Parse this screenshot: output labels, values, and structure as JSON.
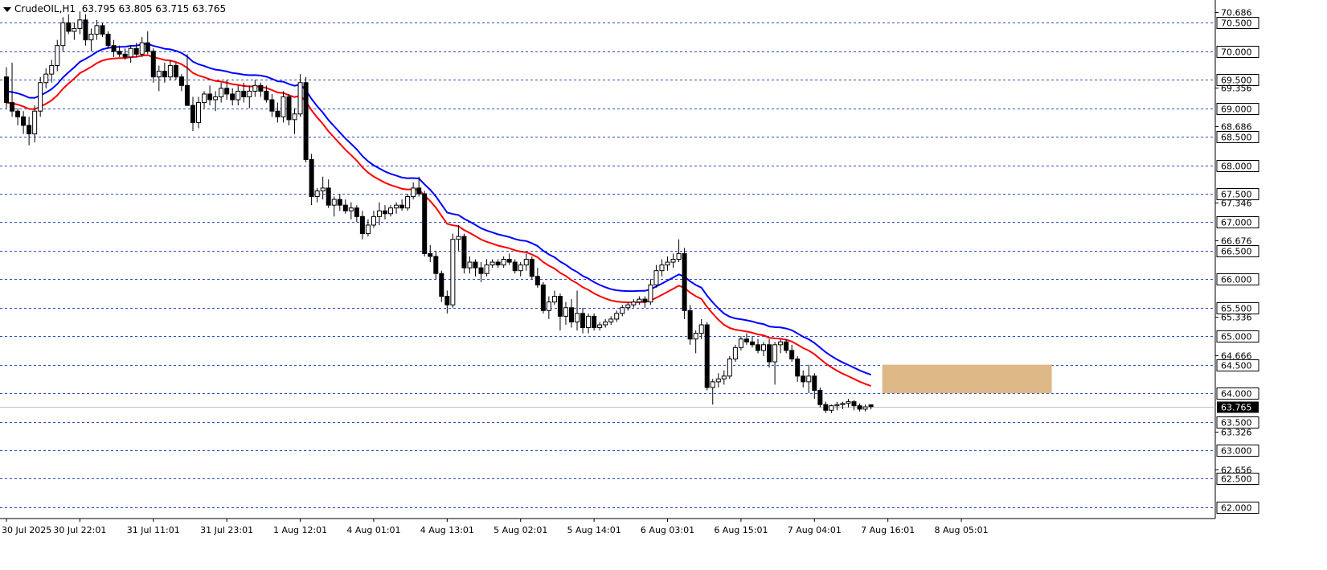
{
  "header": {
    "symbol": "CrudeOIL,H1",
    "ohlc": "63.795 63.805 63.715 63.765"
  },
  "colors": {
    "grid": "#2b4fbf",
    "ma_fast": "#0000ff",
    "ma_slow": "#ff0000",
    "zone": "#deb887",
    "current_label_bg": "#000000",
    "current_label_text": "#ffffff"
  },
  "chart_data": {
    "type": "line",
    "title": "CrudeOIL,H1",
    "ylim": [
      61.8,
      70.9
    ],
    "grid": true,
    "y_levels": [
      70.5,
      70.0,
      69.5,
      69.0,
      68.5,
      68.0,
      67.5,
      67.0,
      66.5,
      66.0,
      65.5,
      65.0,
      64.5,
      64.0,
      63.5,
      63.0,
      62.5,
      62.0
    ],
    "y_level_labels": [
      "70.500",
      "70.000",
      "69.500",
      "69.000",
      "68.500",
      "68.000",
      "67.500",
      "67.000",
      "66.500",
      "66.000",
      "65.500",
      "65.000",
      "64.500",
      "64.000",
      "63.500",
      "63.000",
      "62.500",
      "62.000"
    ],
    "y_tick_values": [
      70.686,
      69.356,
      68.686,
      67.346,
      66.676,
      65.336,
      64.666,
      63.326,
      62.656
    ],
    "y_tick_labels": [
      "70.686",
      "69.356",
      "68.686",
      "67.346",
      "66.676",
      "65.336",
      "64.666",
      "63.326",
      "62.656"
    ],
    "x_labels": [
      "30 Jul 2025",
      "30 Jul 22:01",
      "31 Jul 11:01",
      "31 Jul 23:01",
      "1 Aug 12:01",
      "4 Aug 01:01",
      "4 Aug 13:01",
      "5 Aug 02:01",
      "5 Aug 14:01",
      "6 Aug 03:01",
      "6 Aug 15:01",
      "7 Aug 04:01",
      "7 Aug 16:01",
      "8 Aug 05:01"
    ],
    "x_label_bar_index": [
      0,
      13,
      26,
      39,
      52,
      65,
      78,
      91,
      104,
      117,
      130,
      143,
      156,
      169
    ],
    "current_price": 63.765,
    "current_price_label": "63.765",
    "zone": {
      "x_start_bar": 155,
      "x_end_bar": 185,
      "y_low": 64.0,
      "y_high": 64.5
    },
    "candles": [
      [
        69.55,
        69.72,
        69.0,
        69.1
      ],
      [
        69.1,
        69.8,
        68.85,
        68.95
      ],
      [
        68.95,
        69.0,
        68.7,
        68.85
      ],
      [
        68.85,
        68.95,
        68.55,
        68.7
      ],
      [
        68.7,
        68.85,
        68.35,
        68.55
      ],
      [
        68.55,
        69.05,
        68.4,
        68.95
      ],
      [
        68.95,
        69.55,
        68.85,
        69.45
      ],
      [
        69.45,
        69.7,
        69.35,
        69.6
      ],
      [
        69.6,
        69.85,
        69.45,
        69.75
      ],
      [
        69.75,
        70.2,
        69.65,
        70.1
      ],
      [
        70.1,
        70.6,
        70.0,
        70.5
      ],
      [
        70.5,
        70.65,
        70.3,
        70.35
      ],
      [
        70.35,
        70.5,
        70.2,
        70.4
      ],
      [
        70.4,
        70.7,
        70.3,
        70.55
      ],
      [
        70.55,
        70.65,
        70.1,
        70.2
      ],
      [
        70.2,
        70.4,
        70.0,
        70.3
      ],
      [
        70.3,
        70.55,
        70.2,
        70.45
      ],
      [
        70.45,
        70.5,
        70.25,
        70.3
      ],
      [
        70.3,
        70.35,
        70.05,
        70.1
      ],
      [
        70.1,
        70.2,
        69.9,
        70.0
      ],
      [
        70.0,
        70.1,
        69.9,
        69.95
      ],
      [
        69.95,
        70.05,
        69.85,
        69.9
      ],
      [
        69.9,
        70.1,
        69.8,
        70.05
      ],
      [
        70.05,
        70.15,
        69.9,
        69.95
      ],
      [
        69.95,
        70.25,
        69.9,
        70.15
      ],
      [
        70.15,
        70.35,
        69.95,
        70.0
      ],
      [
        70.0,
        70.05,
        69.45,
        69.55
      ],
      [
        69.55,
        69.75,
        69.3,
        69.65
      ],
      [
        69.65,
        69.8,
        69.45,
        69.55
      ],
      [
        69.55,
        69.85,
        69.5,
        69.75
      ],
      [
        69.75,
        69.8,
        69.5,
        69.55
      ],
      [
        69.55,
        69.6,
        69.3,
        69.4
      ],
      [
        69.4,
        69.95,
        69.2,
        69.05
      ],
      [
        69.05,
        69.2,
        68.6,
        68.75
      ],
      [
        68.75,
        69.2,
        68.65,
        69.1
      ],
      [
        69.1,
        69.3,
        69.0,
        69.25
      ],
      [
        69.25,
        69.4,
        69.05,
        69.15
      ],
      [
        69.15,
        69.3,
        68.95,
        69.2
      ],
      [
        69.2,
        69.45,
        69.1,
        69.35
      ],
      [
        69.35,
        69.5,
        69.15,
        69.25
      ],
      [
        69.25,
        69.35,
        69.05,
        69.15
      ],
      [
        69.15,
        69.4,
        69.05,
        69.3
      ],
      [
        69.3,
        69.45,
        69.1,
        69.2
      ],
      [
        69.2,
        69.4,
        69.0,
        69.3
      ],
      [
        69.3,
        69.5,
        69.2,
        69.4
      ],
      [
        69.4,
        69.45,
        69.2,
        69.3
      ],
      [
        69.3,
        69.4,
        69.1,
        69.15
      ],
      [
        69.15,
        69.25,
        68.85,
        68.95
      ],
      [
        68.95,
        69.1,
        68.75,
        68.85
      ],
      [
        68.85,
        69.3,
        68.75,
        69.2
      ],
      [
        69.2,
        69.25,
        68.7,
        68.8
      ],
      [
        68.8,
        69.0,
        68.55,
        68.9
      ],
      [
        68.9,
        69.6,
        68.85,
        69.45
      ],
      [
        69.45,
        69.55,
        68.05,
        68.1
      ],
      [
        68.1,
        68.2,
        67.3,
        67.45
      ],
      [
        67.45,
        67.6,
        67.35,
        67.55
      ],
      [
        67.55,
        67.8,
        67.4,
        67.6
      ],
      [
        67.6,
        67.75,
        67.25,
        67.3
      ],
      [
        67.3,
        67.45,
        67.1,
        67.4
      ],
      [
        67.4,
        67.5,
        67.2,
        67.3
      ],
      [
        67.3,
        67.4,
        67.15,
        67.2
      ],
      [
        67.2,
        67.35,
        67.05,
        67.25
      ],
      [
        67.25,
        67.3,
        67.0,
        67.1
      ],
      [
        67.1,
        67.2,
        66.7,
        66.8
      ],
      [
        66.8,
        67.05,
        66.75,
        66.95
      ],
      [
        66.95,
        67.2,
        66.9,
        67.1
      ],
      [
        67.1,
        67.35,
        66.95,
        67.2
      ],
      [
        67.2,
        67.3,
        67.05,
        67.15
      ],
      [
        67.15,
        67.3,
        67.1,
        67.25
      ],
      [
        67.25,
        67.35,
        67.15,
        67.3
      ],
      [
        67.3,
        67.4,
        67.2,
        67.25
      ],
      [
        67.25,
        67.5,
        67.2,
        67.45
      ],
      [
        67.45,
        67.7,
        67.4,
        67.6
      ],
      [
        67.6,
        67.8,
        67.45,
        67.5
      ],
      [
        67.5,
        67.55,
        66.4,
        66.45
      ],
      [
        66.45,
        66.6,
        66.3,
        66.4
      ],
      [
        66.4,
        66.5,
        66.0,
        66.1
      ],
      [
        66.1,
        66.15,
        65.6,
        65.7
      ],
      [
        65.7,
        65.8,
        65.4,
        65.55
      ],
      [
        65.55,
        66.8,
        65.5,
        66.7
      ],
      [
        66.7,
        66.95,
        66.5,
        66.75
      ],
      [
        66.75,
        66.8,
        66.1,
        66.2
      ],
      [
        66.2,
        66.4,
        66.1,
        66.3
      ],
      [
        66.3,
        66.35,
        66.05,
        66.2
      ],
      [
        66.2,
        66.3,
        65.95,
        66.1
      ],
      [
        66.1,
        66.35,
        66.05,
        66.25
      ],
      [
        66.25,
        66.35,
        66.2,
        66.3
      ],
      [
        66.3,
        66.35,
        66.2,
        66.25
      ],
      [
        66.25,
        66.4,
        66.2,
        66.35
      ],
      [
        66.35,
        66.45,
        66.25,
        66.3
      ],
      [
        66.3,
        66.35,
        66.1,
        66.15
      ],
      [
        66.15,
        66.3,
        66.05,
        66.25
      ],
      [
        66.25,
        66.45,
        66.15,
        66.35
      ],
      [
        66.35,
        66.4,
        66.0,
        66.05
      ],
      [
        66.05,
        66.2,
        65.85,
        65.9
      ],
      [
        65.9,
        65.95,
        65.4,
        65.45
      ],
      [
        65.45,
        65.7,
        65.3,
        65.6
      ],
      [
        65.6,
        65.8,
        65.55,
        65.7
      ],
      [
        65.7,
        65.75,
        65.1,
        65.35
      ],
      [
        65.35,
        65.6,
        65.2,
        65.5
      ],
      [
        65.5,
        65.65,
        65.15,
        65.25
      ],
      [
        65.25,
        65.8,
        65.1,
        65.4
      ],
      [
        65.4,
        65.5,
        65.05,
        65.15
      ],
      [
        65.15,
        65.4,
        65.05,
        65.35
      ],
      [
        65.35,
        65.4,
        65.1,
        65.15
      ],
      [
        65.15,
        65.25,
        65.1,
        65.2
      ],
      [
        65.2,
        65.3,
        65.15,
        65.25
      ],
      [
        65.25,
        65.35,
        65.2,
        65.3
      ],
      [
        65.3,
        65.45,
        65.25,
        65.4
      ],
      [
        65.4,
        65.55,
        65.35,
        65.5
      ],
      [
        65.5,
        65.6,
        65.45,
        65.55
      ],
      [
        65.55,
        65.65,
        65.5,
        65.6
      ],
      [
        65.6,
        65.7,
        65.55,
        65.65
      ],
      [
        65.65,
        65.7,
        65.5,
        65.6
      ],
      [
        65.6,
        66.0,
        65.55,
        65.9
      ],
      [
        65.9,
        66.25,
        65.85,
        66.15
      ],
      [
        66.15,
        66.35,
        66.05,
        66.25
      ],
      [
        66.25,
        66.4,
        66.15,
        66.3
      ],
      [
        66.3,
        66.45,
        66.2,
        66.35
      ],
      [
        66.35,
        66.7,
        66.3,
        66.45
      ],
      [
        66.45,
        66.55,
        65.3,
        65.45
      ],
      [
        65.45,
        65.55,
        64.85,
        64.95
      ],
      [
        64.95,
        65.1,
        64.7,
        65.05
      ],
      [
        65.05,
        65.3,
        64.95,
        65.2
      ],
      [
        65.2,
        65.25,
        64.05,
        64.1
      ],
      [
        64.1,
        64.25,
        63.8,
        64.2
      ],
      [
        64.2,
        64.35,
        64.1,
        64.25
      ],
      [
        64.25,
        64.4,
        64.15,
        64.3
      ],
      [
        64.3,
        64.65,
        64.25,
        64.6
      ],
      [
        64.6,
        64.85,
        64.55,
        64.8
      ],
      [
        64.8,
        65.0,
        64.75,
        64.95
      ],
      [
        64.95,
        65.05,
        64.85,
        64.9
      ],
      [
        64.9,
        65.0,
        64.8,
        64.85
      ],
      [
        64.85,
        64.95,
        64.7,
        64.75
      ],
      [
        64.75,
        64.9,
        64.65,
        64.85
      ],
      [
        64.85,
        64.95,
        64.45,
        64.55
      ],
      [
        64.55,
        64.9,
        64.15,
        64.85
      ],
      [
        64.85,
        64.95,
        64.7,
        64.9
      ],
      [
        64.9,
        64.95,
        64.7,
        64.75
      ],
      [
        64.75,
        64.85,
        64.55,
        64.6
      ],
      [
        64.6,
        64.65,
        64.2,
        64.3
      ],
      [
        64.3,
        64.4,
        64.1,
        64.2
      ],
      [
        64.2,
        64.5,
        64.0,
        64.3
      ],
      [
        64.3,
        64.35,
        63.9,
        64.05
      ],
      [
        64.05,
        64.1,
        63.75,
        63.8
      ],
      [
        63.8,
        63.85,
        63.65,
        63.7
      ],
      [
        63.7,
        63.8,
        63.65,
        63.78
      ],
      [
        63.78,
        63.85,
        63.7,
        63.8
      ],
      [
        63.8,
        63.85,
        63.72,
        63.82
      ],
      [
        63.82,
        63.9,
        63.75,
        63.85
      ],
      [
        63.85,
        63.88,
        63.7,
        63.78
      ],
      [
        63.78,
        63.82,
        63.68,
        63.72
      ],
      [
        63.72,
        63.8,
        63.68,
        63.76
      ],
      [
        63.795,
        63.805,
        63.715,
        63.765
      ]
    ]
  }
}
